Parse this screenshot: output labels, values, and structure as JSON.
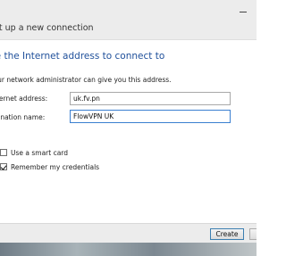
{
  "window": {
    "title": "Set up a new connection",
    "heading": "Type the Internet address to connect to",
    "helper_text": "Your network administrator can give you this address."
  },
  "form": {
    "internet_address_label": "Internet address:",
    "internet_address_value": "uk.fv.pn",
    "destination_name_label": "Destination name:",
    "destination_name_value": "FlowVPN UK",
    "use_smart_card_label": "Use a smart card",
    "use_smart_card_checked": false,
    "remember_credentials_label": "Remember my credentials",
    "remember_credentials_checked": true
  },
  "buttons": {
    "create_label": "Create"
  },
  "colors": {
    "heading": "#1e4f9a",
    "titlebar": "#ececec",
    "focused_border": "#3a7fd0"
  }
}
